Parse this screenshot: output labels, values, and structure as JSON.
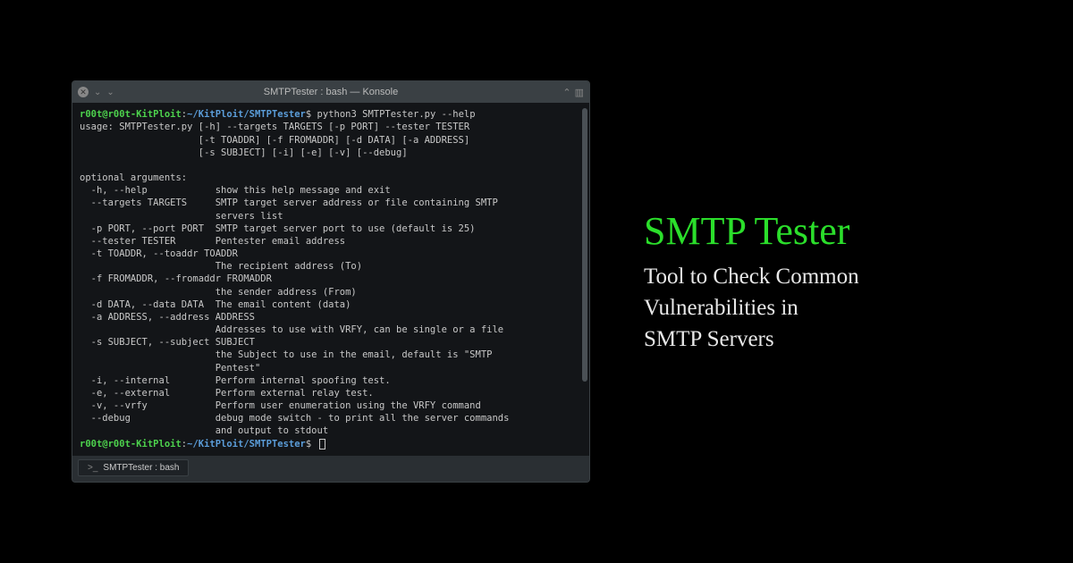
{
  "titlebar": {
    "title": "SMTPTester : bash — Konsole"
  },
  "prompt": {
    "user": "r00t@r00t-KitPloit",
    "sep": ":",
    "path": "~/KitPloit/SMTPTester",
    "dollar": "$"
  },
  "command": "python3 SMTPTester.py --help",
  "output": "usage: SMTPTester.py [-h] --targets TARGETS [-p PORT] --tester TESTER\n                     [-t TOADDR] [-f FROMADDR] [-d DATA] [-a ADDRESS]\n                     [-s SUBJECT] [-i] [-e] [-v] [--debug]\n\noptional arguments:\n  -h, --help            show this help message and exit\n  --targets TARGETS     SMTP target server address or file containing SMTP\n                        servers list\n  -p PORT, --port PORT  SMTP target server port to use (default is 25)\n  --tester TESTER       Pentester email address\n  -t TOADDR, --toaddr TOADDR\n                        The recipient address (To)\n  -f FROMADDR, --fromaddr FROMADDR\n                        the sender address (From)\n  -d DATA, --data DATA  The email content (data)\n  -a ADDRESS, --address ADDRESS\n                        Addresses to use with VRFY, can be single or a file\n  -s SUBJECT, --subject SUBJECT\n                        the Subject to use in the email, default is \"SMTP\n                        Pentest\"\n  -i, --internal        Perform internal spoofing test.\n  -e, --external        Perform external relay test.\n  -v, --vrfy            Perform user enumeration using the VRFY command\n  --debug               debug mode switch - to print all the server commands\n                        and output to stdout",
  "tab": {
    "label": "SMTPTester : bash"
  },
  "right": {
    "title": "SMTP Tester",
    "subtitle": "Tool to Check Common\nVulnerabilities in\nSMTP Servers"
  }
}
